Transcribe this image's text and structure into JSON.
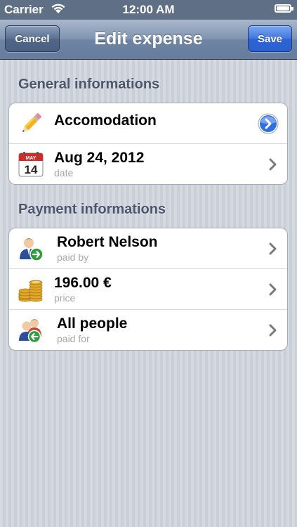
{
  "status": {
    "carrier": "Carrier",
    "time": "12:00 AM"
  },
  "nav": {
    "title": "Edit expense",
    "cancel": "Cancel",
    "save": "Save"
  },
  "sections": {
    "general": {
      "header": "General informations",
      "category": "Accomodation",
      "date": {
        "value": "Aug 24, 2012",
        "label": "date",
        "cal_month": "MAY",
        "cal_day": "14"
      }
    },
    "payment": {
      "header": "Payment informations",
      "paid_by": {
        "value": "Robert Nelson",
        "label": "paid by"
      },
      "price": {
        "value": "196.00 €",
        "label": "price"
      },
      "paid_for": {
        "value": "All people",
        "label": "paid for"
      }
    }
  },
  "colors": {
    "accent": "#2b60cf",
    "nav": "#6d84a4",
    "background": "#c9ced8"
  },
  "icons": [
    "pencil-icon",
    "calendar-icon",
    "person-arrow-icon",
    "coins-icon",
    "group-icon",
    "chevron-right-icon",
    "disclosure-button-icon"
  ]
}
